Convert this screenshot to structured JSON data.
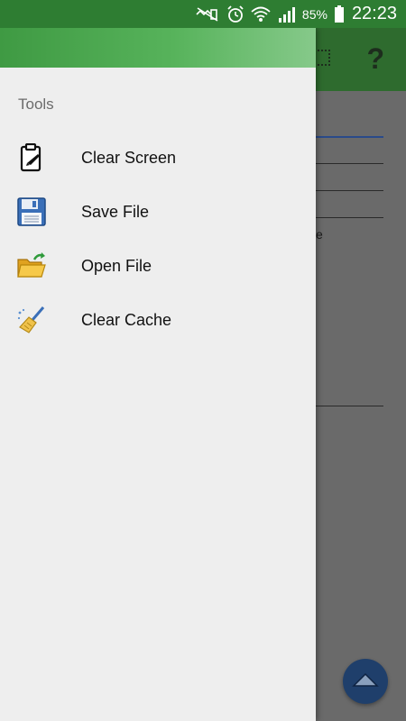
{
  "status_bar": {
    "battery_pct": "85%",
    "time": "22:23",
    "icons": [
      "mute-icon",
      "alarm-icon",
      "wifi-icon",
      "signal-icon",
      "battery-icon"
    ]
  },
  "background": {
    "help_glyph": "?",
    "partial_text": "e"
  },
  "drawer": {
    "section_title": "Tools",
    "items": [
      {
        "label": "Clear Screen",
        "icon": "clipboard-icon"
      },
      {
        "label": "Save File",
        "icon": "floppy-disk-icon"
      },
      {
        "label": "Open File",
        "icon": "open-folder-icon"
      },
      {
        "label": "Clear Cache",
        "icon": "broom-icon"
      }
    ]
  },
  "colors": {
    "status_bar": "#2e7d32",
    "drawer_header_start": "#3f9a43",
    "drawer_header_end": "#86c98a",
    "drawer_bg": "#eeeeee",
    "fab": "#1f3f6b"
  }
}
